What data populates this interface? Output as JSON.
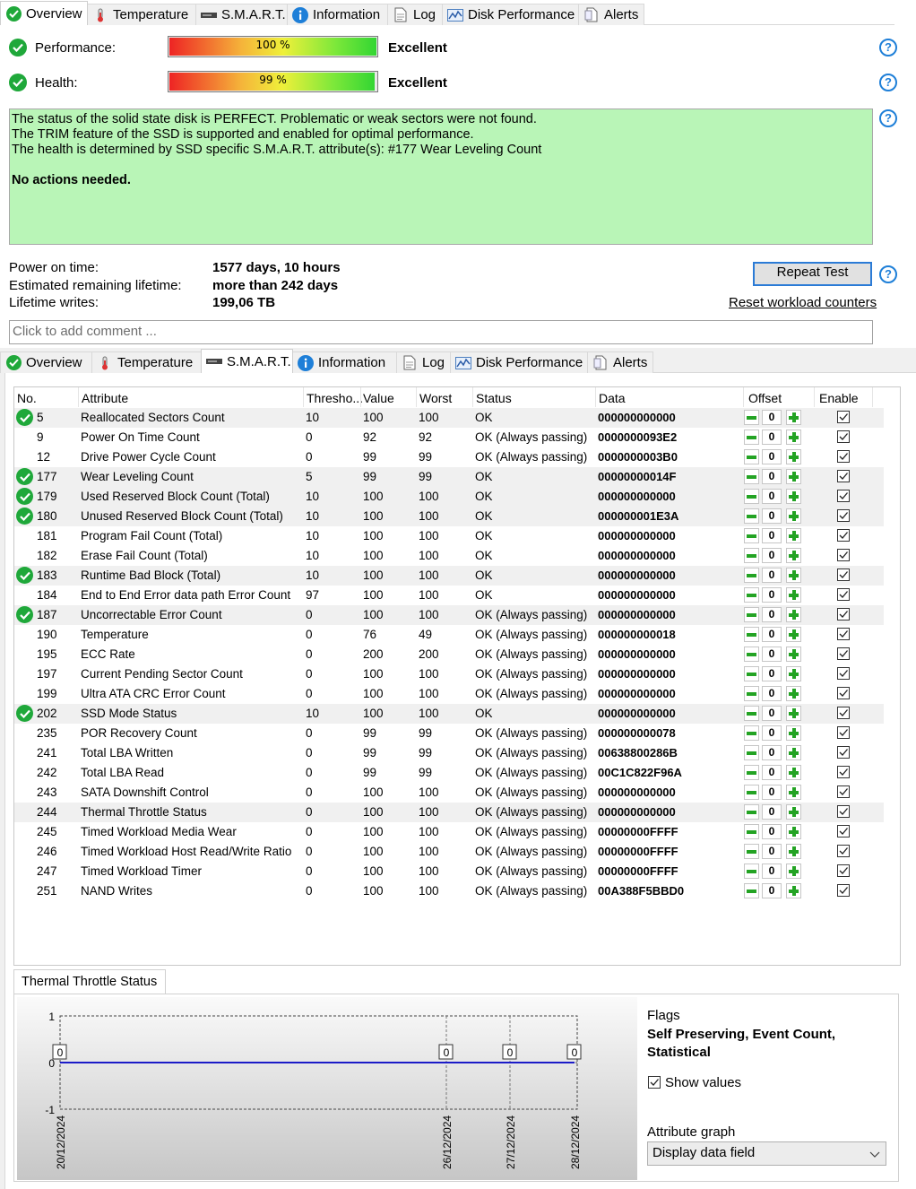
{
  "tabs": [
    {
      "label": "Overview",
      "icon": "check-icon"
    },
    {
      "label": "Temperature",
      "icon": "thermometer-icon"
    },
    {
      "label": "S.M.A.R.T.",
      "icon": "drive-icon"
    },
    {
      "label": "Information",
      "icon": "info-icon"
    },
    {
      "label": "Log",
      "icon": "document-icon"
    },
    {
      "label": "Disk Performance",
      "icon": "performance-chart-icon"
    },
    {
      "label": "Alerts",
      "icon": "alerts-icon"
    }
  ],
  "overview": {
    "performance": {
      "label": "Performance:",
      "percent": 100,
      "text": "100 %",
      "rating": "Excellent"
    },
    "health": {
      "label": "Health:",
      "percent": 99,
      "text": "99 %",
      "rating": "Excellent"
    },
    "status_lines": [
      "The status of the solid state disk is PERFECT. Problematic or weak sectors were not found.",
      "The TRIM feature of the SSD is supported and enabled for optimal performance.",
      "The health is determined by SSD specific S.M.A.R.T. attribute(s):  #177 Wear Leveling Count"
    ],
    "status_action": "No actions needed.",
    "power_on_label": "Power on time:",
    "power_on_value": "1577 days, 10 hours",
    "remaining_label": "Estimated remaining lifetime:",
    "remaining_value": "more than 242 days",
    "writes_label": "Lifetime writes:",
    "writes_value": "199,06 TB",
    "repeat_test": "Repeat Test",
    "reset_counters": "Reset workload counters",
    "comment_placeholder": "Click to add comment ...",
    "help_glyph": "?"
  },
  "smart": {
    "columns": [
      "No.",
      "Attribute",
      "Thresho...",
      "Value",
      "Worst",
      "Status",
      "Data",
      "Offset",
      "Enable"
    ],
    "rows": [
      {
        "ok": true,
        "no": "5",
        "attr": "Reallocated Sectors Count",
        "thr": "10",
        "val": "100",
        "worst": "100",
        "status": "OK",
        "data": "000000000000",
        "offset": "0"
      },
      {
        "ok": false,
        "no": "9",
        "attr": "Power On Time Count",
        "thr": "0",
        "val": "92",
        "worst": "92",
        "status": "OK (Always passing)",
        "data": "0000000093E2",
        "offset": "0"
      },
      {
        "ok": false,
        "no": "12",
        "attr": "Drive Power Cycle Count",
        "thr": "0",
        "val": "99",
        "worst": "99",
        "status": "OK (Always passing)",
        "data": "0000000003B0",
        "offset": "0"
      },
      {
        "ok": true,
        "no": "177",
        "attr": "Wear Leveling Count",
        "thr": "5",
        "val": "99",
        "worst": "99",
        "status": "OK",
        "data": "00000000014F",
        "offset": "0"
      },
      {
        "ok": true,
        "no": "179",
        "attr": "Used Reserved Block Count (Total)",
        "thr": "10",
        "val": "100",
        "worst": "100",
        "status": "OK",
        "data": "000000000000",
        "offset": "0"
      },
      {
        "ok": true,
        "no": "180",
        "attr": "Unused Reserved Block Count (Total)",
        "thr": "10",
        "val": "100",
        "worst": "100",
        "status": "OK",
        "data": "000000001E3A",
        "offset": "0"
      },
      {
        "ok": false,
        "no": "181",
        "attr": "Program Fail Count (Total)",
        "thr": "10",
        "val": "100",
        "worst": "100",
        "status": "OK",
        "data": "000000000000",
        "offset": "0"
      },
      {
        "ok": false,
        "no": "182",
        "attr": "Erase Fail Count (Total)",
        "thr": "10",
        "val": "100",
        "worst": "100",
        "status": "OK",
        "data": "000000000000",
        "offset": "0"
      },
      {
        "ok": true,
        "no": "183",
        "attr": "Runtime Bad Block (Total)",
        "thr": "10",
        "val": "100",
        "worst": "100",
        "status": "OK",
        "data": "000000000000",
        "offset": "0"
      },
      {
        "ok": false,
        "no": "184",
        "attr": "End to End Error data path Error Count",
        "thr": "97",
        "val": "100",
        "worst": "100",
        "status": "OK",
        "data": "000000000000",
        "offset": "0"
      },
      {
        "ok": true,
        "no": "187",
        "attr": "Uncorrectable Error Count",
        "thr": "0",
        "val": "100",
        "worst": "100",
        "status": "OK (Always passing)",
        "data": "000000000000",
        "offset": "0"
      },
      {
        "ok": false,
        "no": "190",
        "attr": "Temperature",
        "thr": "0",
        "val": "76",
        "worst": "49",
        "status": "OK (Always passing)",
        "data": "000000000018",
        "offset": "0"
      },
      {
        "ok": false,
        "no": "195",
        "attr": "ECC Rate",
        "thr": "0",
        "val": "200",
        "worst": "200",
        "status": "OK (Always passing)",
        "data": "000000000000",
        "offset": "0"
      },
      {
        "ok": false,
        "no": "197",
        "attr": "Current Pending Sector Count",
        "thr": "0",
        "val": "100",
        "worst": "100",
        "status": "OK (Always passing)",
        "data": "000000000000",
        "offset": "0"
      },
      {
        "ok": false,
        "no": "199",
        "attr": "Ultra ATA CRC Error Count",
        "thr": "0",
        "val": "100",
        "worst": "100",
        "status": "OK (Always passing)",
        "data": "000000000000",
        "offset": "0"
      },
      {
        "ok": true,
        "no": "202",
        "attr": "SSD Mode Status",
        "thr": "10",
        "val": "100",
        "worst": "100",
        "status": "OK",
        "data": "000000000000",
        "offset": "0"
      },
      {
        "ok": false,
        "no": "235",
        "attr": "POR Recovery Count",
        "thr": "0",
        "val": "99",
        "worst": "99",
        "status": "OK (Always passing)",
        "data": "000000000078",
        "offset": "0"
      },
      {
        "ok": false,
        "no": "241",
        "attr": "Total LBA Written",
        "thr": "0",
        "val": "99",
        "worst": "99",
        "status": "OK (Always passing)",
        "data": "00638800286B",
        "offset": "0"
      },
      {
        "ok": false,
        "no": "242",
        "attr": "Total LBA Read",
        "thr": "0",
        "val": "99",
        "worst": "99",
        "status": "OK (Always passing)",
        "data": "00C1C822F96A",
        "offset": "0"
      },
      {
        "ok": false,
        "no": "243",
        "attr": "SATA Downshift Control",
        "thr": "0",
        "val": "100",
        "worst": "100",
        "status": "OK (Always passing)",
        "data": "000000000000",
        "offset": "0"
      },
      {
        "ok": false,
        "no": "244",
        "attr": "Thermal Throttle Status",
        "thr": "0",
        "val": "100",
        "worst": "100",
        "status": "OK (Always passing)",
        "data": "000000000000",
        "offset": "0"
      },
      {
        "ok": false,
        "no": "245",
        "attr": "Timed Workload Media Wear",
        "thr": "0",
        "val": "100",
        "worst": "100",
        "status": "OK (Always passing)",
        "data": "00000000FFFF",
        "offset": "0"
      },
      {
        "ok": false,
        "no": "246",
        "attr": "Timed Workload Host Read/Write Ratio",
        "thr": "0",
        "val": "100",
        "worst": "100",
        "status": "OK (Always passing)",
        "data": "00000000FFFF",
        "offset": "0"
      },
      {
        "ok": false,
        "no": "247",
        "attr": "Timed Workload Timer",
        "thr": "0",
        "val": "100",
        "worst": "100",
        "status": "OK (Always passing)",
        "data": "00000000FFFF",
        "offset": "0"
      },
      {
        "ok": false,
        "no": "251",
        "attr": "NAND Writes",
        "thr": "0",
        "val": "100",
        "worst": "100",
        "status": "OK (Always passing)",
        "data": "00A388F5BBD0",
        "offset": "0"
      }
    ],
    "selected_row_index": 20
  },
  "detail": {
    "tab_label": "Thermal Throttle Status",
    "flags_label": "Flags",
    "flags_value": "Self Preserving, Event Count, Statistical",
    "show_values_label": "Show values",
    "attribute_graph_label": "Attribute graph",
    "attribute_graph_value": "Display data field"
  },
  "chart_data": {
    "type": "line",
    "x": [
      "20/12/2024",
      "26/12/2024",
      "27/12/2024",
      "28/12/2024"
    ],
    "series": [
      {
        "values": [
          0,
          0,
          0,
          0
        ]
      }
    ],
    "value_labels": [
      "0",
      "0",
      "0",
      "0"
    ],
    "yticks": [
      "1",
      "0",
      "-1"
    ],
    "ylim": [
      -1,
      1
    ],
    "grid": true,
    "colors": {
      "line": "#1c1cc8"
    }
  },
  "colors": {
    "ok_green": "#1fa83a",
    "status_bg": "#b9f5b7",
    "link_blue": "#1e7fd8",
    "plus_minus_green": "#23a323"
  }
}
